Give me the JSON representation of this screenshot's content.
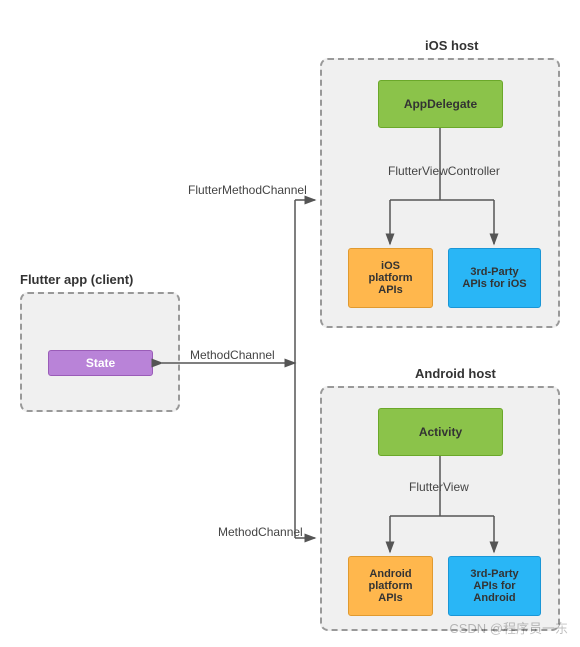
{
  "client": {
    "title": "Flutter app (client)",
    "state_label": "State"
  },
  "ios": {
    "title": "iOS host",
    "delegate": "AppDelegate",
    "controller_label": "FlutterViewController",
    "platform_apis": "iOS\nplatform\nAPIs",
    "third_party": "3rd-Party\nAPIs for iOS"
  },
  "android": {
    "title": "Android host",
    "activity": "Activity",
    "view_label": "FlutterView",
    "platform_apis": "Android\nplatform\nAPIs",
    "third_party": "3rd-Party\nAPIs for\nAndroid"
  },
  "channels": {
    "flutter_method_channel": "FlutterMethodChannel",
    "method_channel_top": "MethodChannel",
    "method_channel_bottom": "MethodChannel"
  },
  "watermark": "CSDN @程序员一东"
}
